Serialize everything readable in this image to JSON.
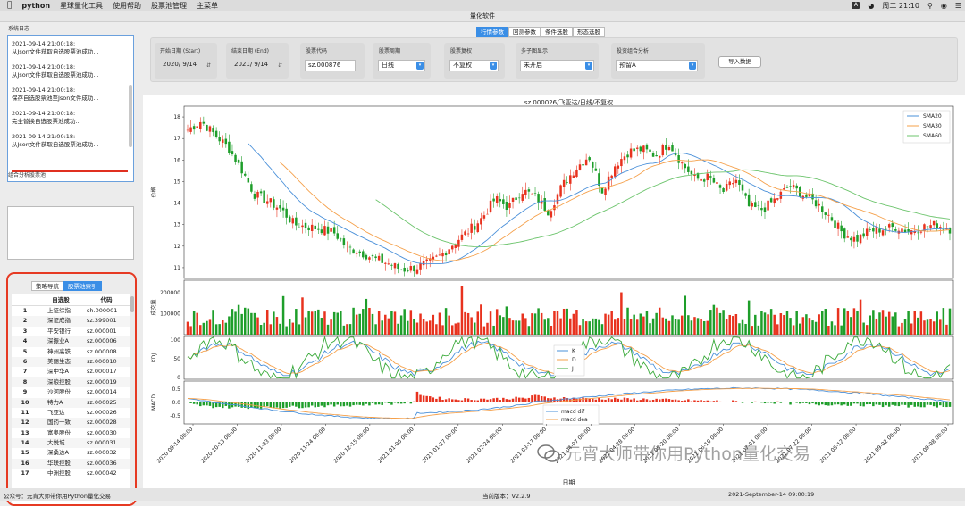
{
  "menubar": {
    "apple": "",
    "app": "python",
    "items": [
      "星球量化工具",
      "使用帮助",
      "股票池管理",
      "主菜单"
    ],
    "ime": "A",
    "clock": "周二 21:10"
  },
  "window": {
    "title": "量化软件"
  },
  "sidebar": {
    "log_title": "系统日志",
    "log_entries": [
      {
        "time": "2021-09-14 21:00:18:",
        "msg": "从Json文件获取自选股票池成功..."
      },
      {
        "time": "2021-09-14 21:00:18:",
        "msg": "从Json文件获取自选股票池成功..."
      },
      {
        "time": "2021-09-14 21:00:18:",
        "msg": "保存自选股票池至Json文件成功..."
      },
      {
        "time": "2021-09-14 21:00:18:",
        "msg": "完全替换自选股票池成功..."
      },
      {
        "time": "2021-09-14 21:00:18:",
        "msg": "从Json文件获取自选股票池成功..."
      }
    ],
    "pool_title": "组合分析股票池",
    "tabs": [
      "策略导航",
      "股票池索引"
    ],
    "table_headers": [
      "自选股",
      "代码"
    ],
    "stocks": [
      [
        "1",
        "上证综指",
        "sh.000001"
      ],
      [
        "2",
        "深证成指",
        "sz.399001"
      ],
      [
        "3",
        "平安银行",
        "sz.000001"
      ],
      [
        "4",
        "深振业A",
        "sz.000006"
      ],
      [
        "5",
        "神州高铁",
        "sz.000008"
      ],
      [
        "6",
        "美丽生态",
        "sz.000010"
      ],
      [
        "7",
        "深中华A",
        "sz.000017"
      ],
      [
        "8",
        "深粮控股",
        "sz.000019"
      ],
      [
        "9",
        "沙河股份",
        "sz.000014"
      ],
      [
        "10",
        "特力A",
        "sz.000025"
      ],
      [
        "11",
        "飞亚达",
        "sz.000026"
      ],
      [
        "12",
        "国药一致",
        "sz.000028"
      ],
      [
        "13",
        "富奥股份",
        "sz.000030"
      ],
      [
        "14",
        "大悦城",
        "sz.000031"
      ],
      [
        "15",
        "深桑达A",
        "sz.000032"
      ],
      [
        "16",
        "华联控股",
        "sz.000036"
      ],
      [
        "17",
        "中洲控股",
        "sz.000042"
      ]
    ]
  },
  "toptabs": [
    "行情参数",
    "回测参数",
    "条件选股",
    "形态选股"
  ],
  "params": {
    "start_label": "开始日期 (Start)",
    "start_value": "2020/ 9/14",
    "end_label": "结束日期 (End)",
    "end_value": "2021/ 9/14",
    "code_label": "股票代码",
    "code_value": "sz.000876",
    "period_label": "股票周期",
    "period_value": "日线",
    "adjust_label": "股票复权",
    "adjust_value": "不复权",
    "sub_label": "多子图显示",
    "sub_value": "未开启",
    "combo_label": "投资组合分析",
    "combo_value": "预留A",
    "import_button": "导入数据"
  },
  "chart_data": {
    "type": "candlestick",
    "title": "sz.000026/飞亚达/日线/不复权",
    "xlabel": "日期",
    "x_ticks": [
      "2020-09-14 00:00",
      "2020-10-13 00:00",
      "2020-11-03 00:00",
      "2020-11-24 00:00",
      "2020-12-15 00:00",
      "2021-01-06 00:00",
      "2021-01-27 00:00",
      "2021-02-24 00:00",
      "2021-03-17 00:00",
      "2021-04-07 00:00",
      "2021-04-28 00:00",
      "2021-05-20 00:00",
      "2021-06-10 00:00",
      "2021-07-01 00:00",
      "2021-07-22 00:00",
      "2021-08-12 00:00",
      "2021-09-02 00:00",
      "2021-09-08 00:00"
    ],
    "price": {
      "ylabel": "价格",
      "ylim": [
        10.5,
        18.5
      ],
      "yticks": [
        11,
        12,
        13,
        14,
        15,
        16,
        17,
        18
      ],
      "legend": [
        "SMA20",
        "SMA30",
        "SMA60"
      ],
      "colors": {
        "up": "#e8321e",
        "down": "#1e9e2a",
        "SMA20": "#4a90d9",
        "SMA30": "#f5a04a",
        "SMA60": "#6cc46c"
      },
      "anchors_close": [
        17.4,
        17.8,
        17.2,
        16.6,
        15.6,
        14.4,
        14.1,
        13.7,
        13.0,
        12.9,
        12.8,
        12.6,
        11.9,
        11.7,
        11.4,
        11.2,
        10.9,
        11.0,
        11.2,
        11.6,
        12.2,
        12.7,
        13.3,
        14.2,
        13.8,
        14.6,
        14.3,
        13.6,
        14.8,
        15.6,
        16.2,
        14.6,
        15.8,
        16.4,
        16.5,
        16.2,
        16.8,
        15.8,
        15.1,
        15.2,
        14.5,
        15.1,
        13.8,
        13.7,
        14.2,
        14.8,
        14.4,
        14.0,
        13.4,
        12.6,
        12.3,
        12.7,
        12.8,
        12.9,
        12.7,
        12.9,
        13.0,
        12.8
      ]
    },
    "volume": {
      "ylabel": "成交量",
      "yticks": [
        100000,
        200000
      ],
      "ylim": [
        0,
        260000
      ]
    },
    "kdj": {
      "ylabel": "KDJ",
      "yticks": [
        0,
        50,
        100
      ],
      "ylim": [
        -5,
        110
      ],
      "legend": [
        "K",
        "D",
        "J"
      ],
      "colors": {
        "K": "#4a90d9",
        "D": "#f5a04a",
        "J": "#3aaa3a"
      }
    },
    "macd": {
      "ylabel": "MACD",
      "yticks": [
        -0.5,
        0.0,
        0.5
      ],
      "ylim": [
        -0.8,
        0.8
      ],
      "legend": [
        "macd dif",
        "macd dea"
      ],
      "colors": {
        "dif": "#4a90d9",
        "dea": "#f5a04a"
      }
    }
  },
  "watermark": "元宵大师带你用Python量化交易",
  "statusbar": {
    "left": "公众号：元宵大师带你用Python量化交易",
    "center": "当前版本：V2.2.9",
    "right": "2021-September-14 09:00:19"
  }
}
